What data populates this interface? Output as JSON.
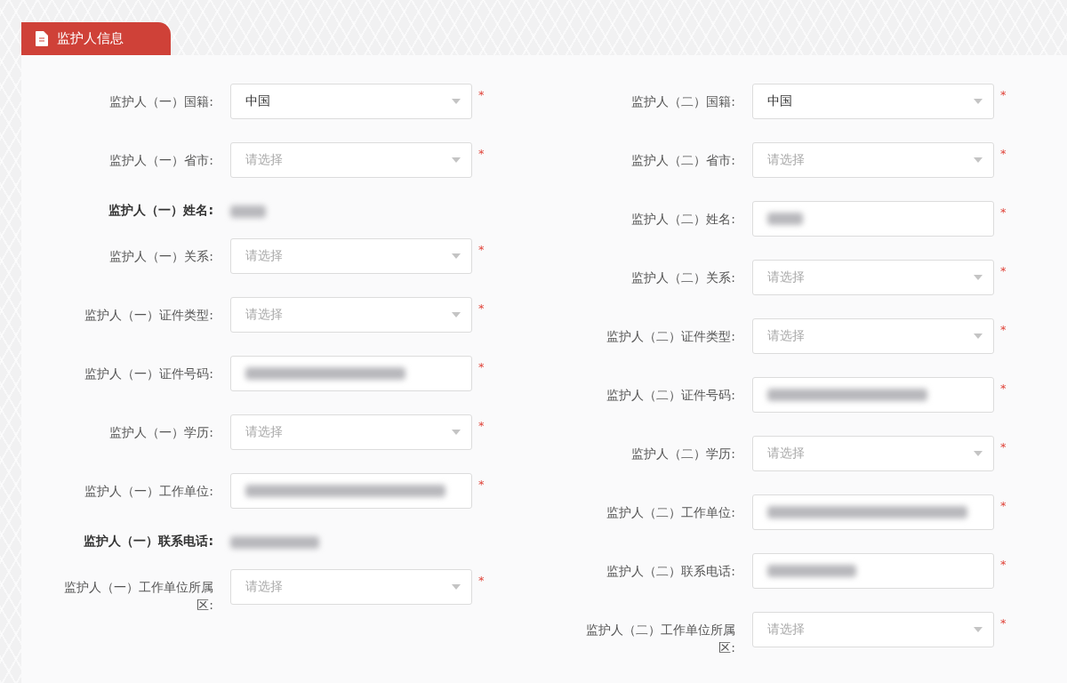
{
  "section_tab": {
    "title": "监护人信息"
  },
  "columns": [
    {
      "fields": [
        {
          "label": "监护人（一）国籍:",
          "kind": "select",
          "value": "中国",
          "mark": "*"
        },
        {
          "label": "监护人（一）省市:",
          "kind": "select",
          "placeholder": "请选择",
          "mark": "*"
        },
        {
          "label": "监护人（一）姓名:",
          "kind": "text",
          "blurred": true
        },
        {
          "label": "监护人（一）关系:",
          "kind": "select",
          "placeholder": "请选择",
          "mark": "*"
        },
        {
          "label": "监护人（一）证件类型:",
          "kind": "select",
          "placeholder": "请选择",
          "mark": "*"
        },
        {
          "label": "监护人（一）证件号码:",
          "kind": "input",
          "blurred": true,
          "mark": "*"
        },
        {
          "label": "监护人（一）学历:",
          "kind": "select",
          "placeholder": "请选择",
          "mark": "*"
        },
        {
          "label": "监护人（一）工作单位:",
          "kind": "input",
          "blurred": true,
          "mark": "*"
        },
        {
          "label": "监护人（一）联系电话:",
          "kind": "text",
          "blurred": true
        },
        {
          "label": "监护人（一）工作单位所属区:",
          "kind": "select",
          "placeholder": "请选择",
          "mark": "*"
        }
      ]
    },
    {
      "fields": [
        {
          "label": "监护人（二）国籍:",
          "kind": "select",
          "value": "中国",
          "mark": "*"
        },
        {
          "label": "监护人（二）省市:",
          "kind": "select",
          "placeholder": "请选择",
          "mark": "*"
        },
        {
          "label": "监护人（二）姓名:",
          "kind": "input",
          "blurred": true,
          "mark": "*"
        },
        {
          "label": "监护人（二）关系:",
          "kind": "select",
          "placeholder": "请选择",
          "mark": "*"
        },
        {
          "label": "监护人（二）证件类型:",
          "kind": "select",
          "placeholder": "请选择",
          "mark": "*"
        },
        {
          "label": "监护人（二）证件号码:",
          "kind": "input",
          "blurred": true,
          "mark": "*"
        },
        {
          "label": "监护人（二）学历:",
          "kind": "select",
          "placeholder": "请选择",
          "mark": "*"
        },
        {
          "label": "监护人（二）工作单位:",
          "kind": "input",
          "blurred": true,
          "mark": "*"
        },
        {
          "label": "监护人（二）联系电话:",
          "kind": "input",
          "blurred": true,
          "mark": "*"
        },
        {
          "label": "监护人（二）工作单位所属区:",
          "kind": "select",
          "placeholder": "请选择",
          "mark": "*"
        }
      ]
    }
  ]
}
